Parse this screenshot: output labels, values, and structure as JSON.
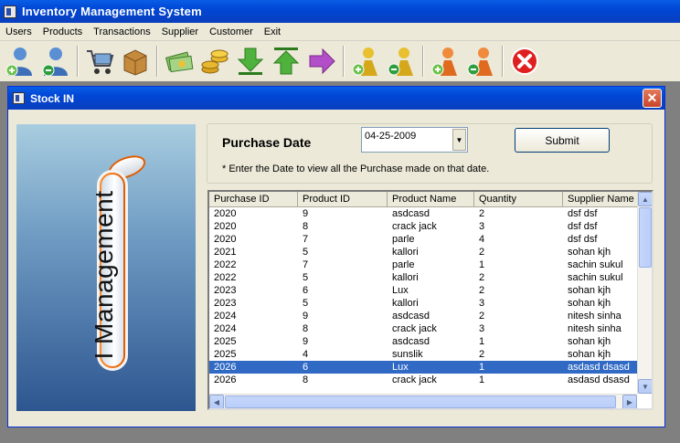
{
  "app": {
    "title": "Inventory Management System"
  },
  "menu": [
    "Users",
    "Products",
    "Transactions",
    "Supplier",
    "Customer",
    "Exit"
  ],
  "toolbar": [
    {
      "icon": "add-user-icon"
    },
    {
      "icon": "remove-user-icon"
    },
    {
      "icon": "shopping-cart-icon"
    },
    {
      "icon": "product-box-icon"
    },
    {
      "icon": "money-icon"
    },
    {
      "icon": "coins-icon"
    },
    {
      "icon": "down-arrow-icon"
    },
    {
      "icon": "up-arrow-icon"
    },
    {
      "icon": "right-arrow-icon"
    },
    {
      "icon": "add-supplier-icon"
    },
    {
      "icon": "remove-supplier-icon"
    },
    {
      "icon": "add-customer-icon"
    },
    {
      "icon": "remove-customer-icon"
    },
    {
      "icon": "exit-icon"
    }
  ],
  "window": {
    "title": "Stock IN",
    "banner_text": "I Management"
  },
  "purchase": {
    "label": "Purchase Date",
    "date_value": "04-25-2009",
    "submit_label": "Submit",
    "hint": "* Enter the Date to view all the Purchase made on that date."
  },
  "grid": {
    "columns": [
      "Purchase ID",
      "Product ID",
      "Product Name",
      "Quantity",
      "Supplier Name"
    ],
    "rows": [
      [
        "2020",
        "9",
        "asdcasd",
        "2",
        "dsf dsf"
      ],
      [
        "2020",
        "8",
        "crack jack",
        "3",
        "dsf dsf"
      ],
      [
        "2020",
        "7",
        "parle",
        "4",
        "dsf dsf"
      ],
      [
        "2021",
        "5",
        "kallori",
        "2",
        "sohan kjh"
      ],
      [
        "2022",
        "7",
        "parle",
        "1",
        "sachin sukul"
      ],
      [
        "2022",
        "5",
        "kallori",
        "2",
        "sachin sukul"
      ],
      [
        "2023",
        "6",
        "Lux",
        "2",
        "sohan kjh"
      ],
      [
        "2023",
        "5",
        "kallori",
        "3",
        "sohan kjh"
      ],
      [
        "2024",
        "9",
        "asdcasd",
        "2",
        "nitesh sinha"
      ],
      [
        "2024",
        "8",
        "crack jack",
        "3",
        "nitesh sinha"
      ],
      [
        "2025",
        "9",
        "asdcasd",
        "1",
        "sohan kjh"
      ],
      [
        "2025",
        "4",
        "sunslik",
        "2",
        "sohan kjh"
      ],
      [
        "2026",
        "6",
        "Lux",
        "1",
        "asdasd dsasd"
      ],
      [
        "2026",
        "8",
        "crack jack",
        "1",
        "asdasd dsasd"
      ]
    ],
    "selected_row": 12
  },
  "colors": {
    "titlebar": "#0046d5",
    "selection": "#316ac5",
    "face": "#ece9d8"
  }
}
